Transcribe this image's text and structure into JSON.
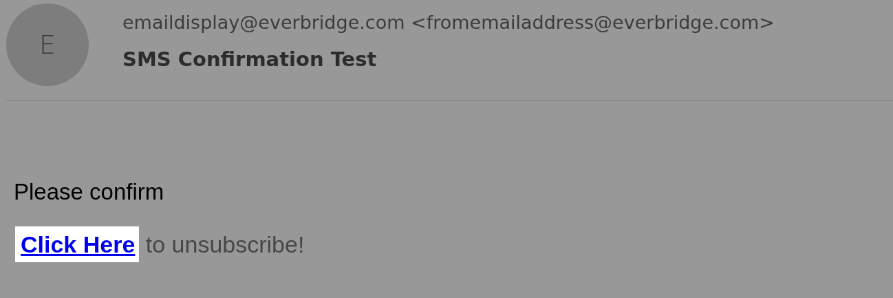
{
  "sender": {
    "initial": "E",
    "display": "emaildisplay@everbridge.com",
    "address": "<fromemailaddress@everbridge.com>"
  },
  "subject": "SMS Confirmation Test",
  "body": {
    "paragraph": "Please confirm",
    "link": "Click Here",
    "link_suffix": "to unsubscribe!"
  }
}
